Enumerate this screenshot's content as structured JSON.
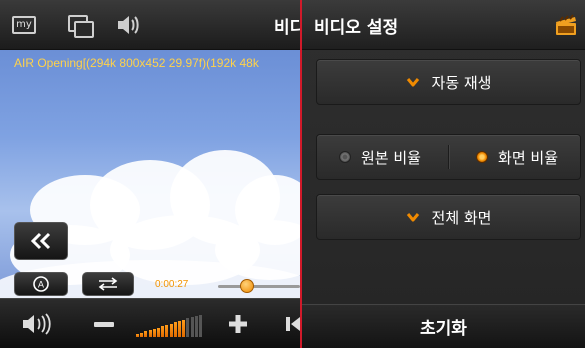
{
  "player": {
    "title": "비디",
    "info_text": "AIR Opening[(294k  800x452  29.97f)(192k  48k",
    "current_time": "0:00:27",
    "seek_fraction": 0.35,
    "volume_level": 0.75,
    "topbar_icons": [
      "my-icon",
      "window-switch-icon",
      "speaker-hand-icon"
    ],
    "accent_color": "#f08a00"
  },
  "settings": {
    "title": "비디오 설정",
    "autoplay_label": "자동 재생",
    "aspect": {
      "original_label": "원본 비율",
      "screen_label": "화면 비율",
      "selected": "screen"
    },
    "fullscreen_label": "전체 화면",
    "reset_label": "초기화"
  },
  "colors": {
    "divider": "#d11a2a",
    "check": "#f08a00"
  }
}
